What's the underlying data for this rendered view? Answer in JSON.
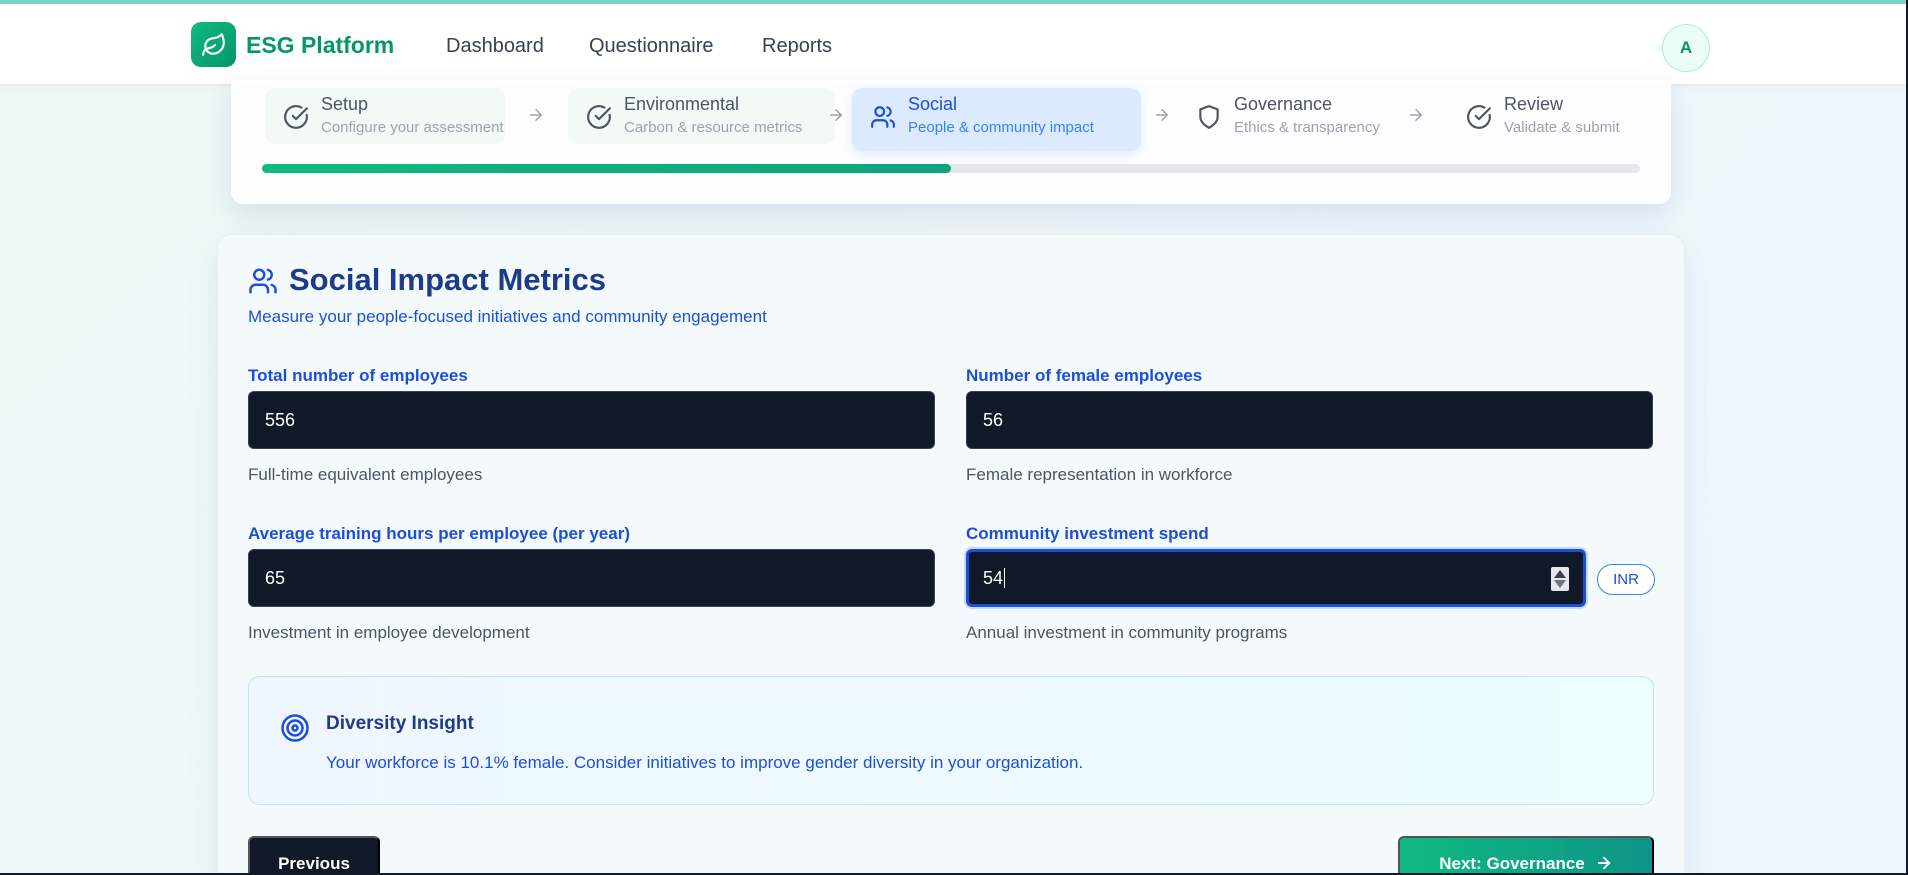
{
  "app": {
    "brand": "ESG Platform",
    "avatar_initial": "A"
  },
  "nav": {
    "items": [
      {
        "label": "Dashboard"
      },
      {
        "label": "Questionnaire"
      },
      {
        "label": "Reports"
      }
    ]
  },
  "stepper": {
    "steps": [
      {
        "title": "Setup",
        "subtitle": "Configure your assessment",
        "state": "done"
      },
      {
        "title": "Environmental",
        "subtitle": "Carbon & resource metrics",
        "state": "done"
      },
      {
        "title": "Social",
        "subtitle": "People & community impact",
        "state": "active"
      },
      {
        "title": "Governance",
        "subtitle": "Ethics & transparency",
        "state": "pending"
      },
      {
        "title": "Review",
        "subtitle": "Validate & submit",
        "state": "pending"
      }
    ],
    "progress_fraction": 0.5
  },
  "section": {
    "title": "Social Impact Metrics",
    "subtitle": "Measure your people-focused initiatives and community engagement"
  },
  "fields": {
    "total_employees": {
      "label": "Total number of employees",
      "value": "556",
      "help": "Full-time equivalent employees"
    },
    "female_employees": {
      "label": "Number of female employees",
      "value": "56",
      "help": "Female representation in workforce"
    },
    "training_hours": {
      "label": "Average training hours per employee (per year)",
      "value": "65",
      "help": "Investment in employee development"
    },
    "community_investment": {
      "label": "Community investment spend",
      "value": "54",
      "help": "Annual investment in community programs",
      "currency": "INR"
    }
  },
  "insight": {
    "title": "Diversity Insight",
    "text": "Your workforce is 10.1% female. Consider initiatives to improve gender diversity in your organization."
  },
  "actions": {
    "previous_label": "Previous",
    "next_label": "Next: Governance"
  },
  "colors": {
    "brand": "#059669",
    "primary": "#1d4ed8",
    "input_bg": "#111827",
    "progress": "#10b981"
  }
}
